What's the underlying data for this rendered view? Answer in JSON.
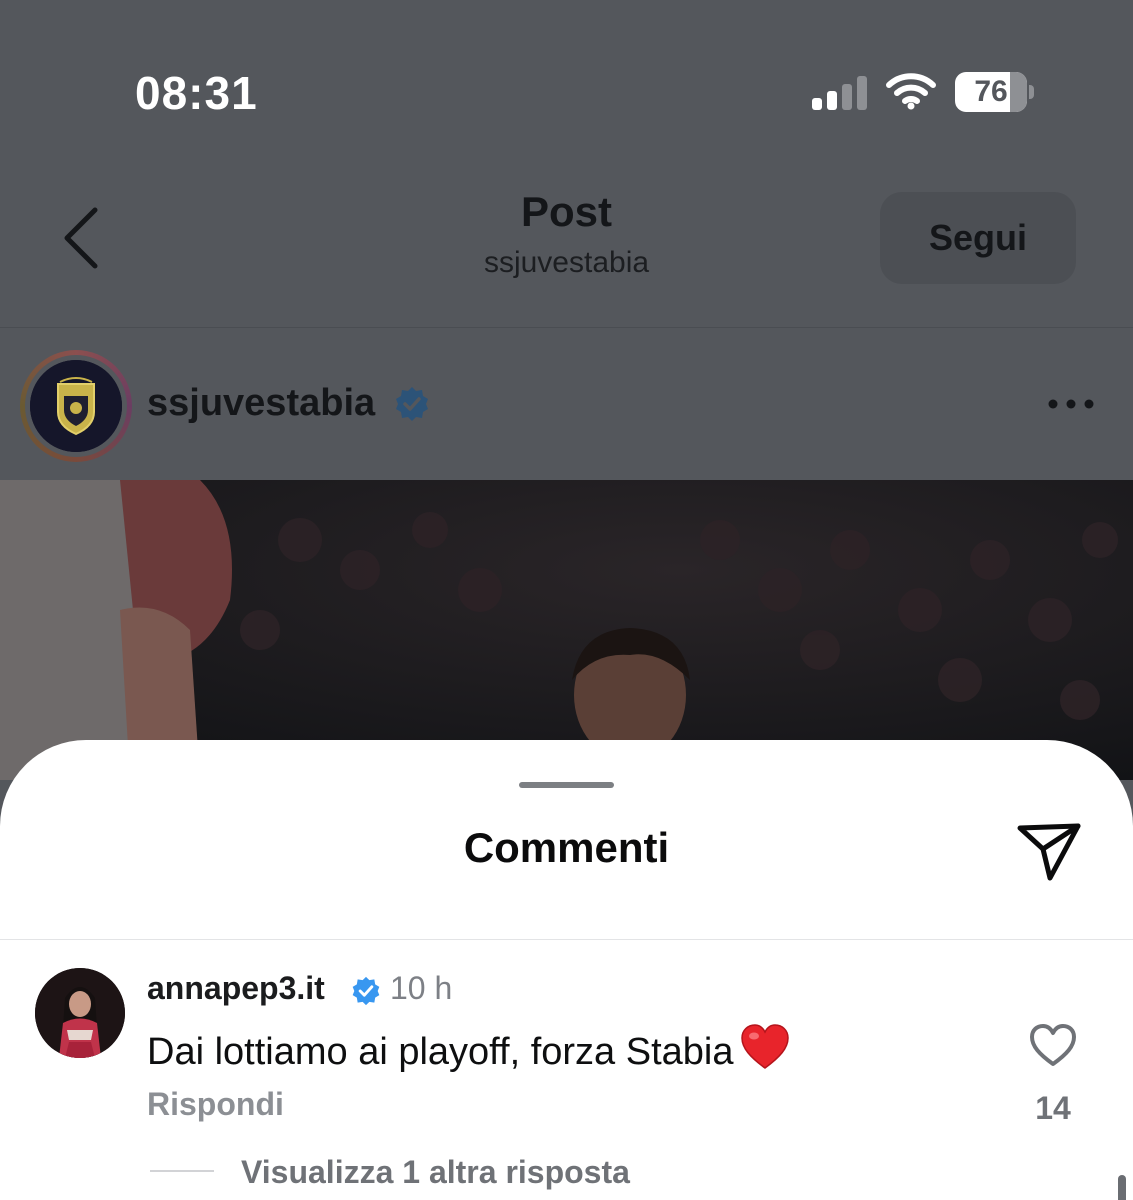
{
  "status_bar": {
    "time": "08:31",
    "battery_level": "76",
    "battery_fraction": 0.76
  },
  "header": {
    "title": "Post",
    "subtitle": "ssjuvestabia",
    "follow_label": "Segui"
  },
  "post": {
    "username": "ssjuvestabia",
    "verified": true
  },
  "comments_sheet": {
    "title": "Commenti",
    "comments": [
      {
        "username": "annapep3.it",
        "verified": true,
        "time": "10 h",
        "text": "Dai lottiamo ai playoff, forza Stabia",
        "emoji": "heart-emoji",
        "reply_label": "Rispondi",
        "like_count": "14",
        "view_replies_label": "Visualizza 1 altra risposta"
      }
    ]
  },
  "colors": {
    "overlay_background": "#54575c",
    "sheet_background": "#ffffff",
    "verified_blue": "#3897f0",
    "heart_red": "#e8242b"
  },
  "icons": [
    "back-chevron-icon",
    "signal-icon",
    "wifi-icon",
    "battery-icon",
    "verified-badge-icon",
    "more-icon",
    "share-send-icon",
    "heart-outline-icon",
    "heart-emoji"
  ]
}
